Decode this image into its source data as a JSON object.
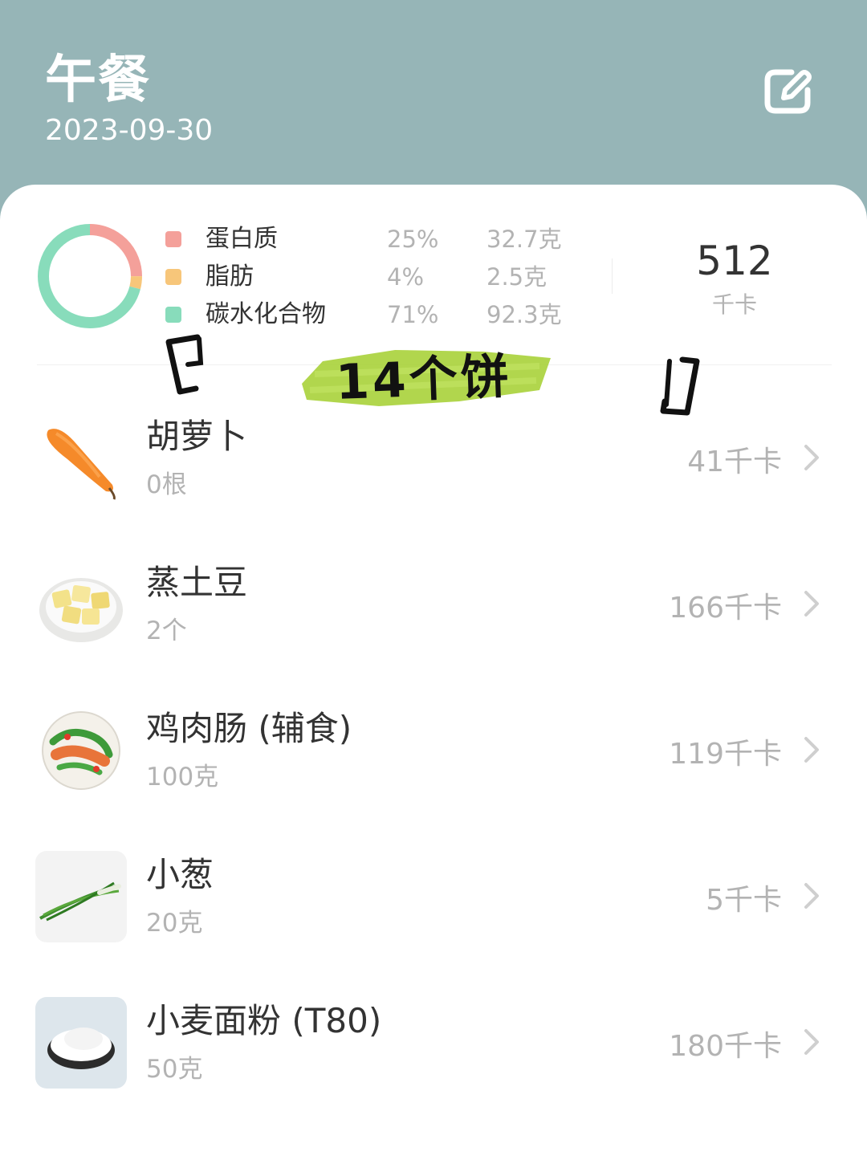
{
  "header": {
    "title": "午餐",
    "date": "2023-09-30",
    "edit_icon": "edit-icon"
  },
  "summary": {
    "macros": [
      {
        "name": "蛋白质",
        "percent": "25%",
        "amount": "32.7克",
        "percent_value": 25,
        "color": "#f4a09a"
      },
      {
        "name": "脂肪",
        "percent": "4%",
        "amount": "2.5克",
        "percent_value": 4,
        "color": "#f7c67a"
      },
      {
        "name": "碳水化合物",
        "percent": "71%",
        "amount": "92.3克",
        "percent_value": 71,
        "color": "#88dcbb"
      }
    ],
    "total_kcal": "512",
    "total_unit": "千卡"
  },
  "annotation": {
    "text": "14个饼",
    "highlight_color": "#a8d13a"
  },
  "foods": [
    {
      "name": "胡萝卜",
      "qty": "0根",
      "kcal": "41千卡",
      "icon": "carrot-image"
    },
    {
      "name": "蒸土豆",
      "qty": "2个",
      "kcal": "166千卡",
      "icon": "steamed-potato-image"
    },
    {
      "name": "鸡肉肠 (辅食)",
      "qty": "100克",
      "kcal": "119千卡",
      "icon": "chicken-sausage-plate-image"
    },
    {
      "name": "小葱",
      "qty": "20克",
      "kcal": "5千卡",
      "icon": "scallion-image"
    },
    {
      "name": "小麦面粉 (T80)",
      "qty": "50克",
      "kcal": "180千卡",
      "icon": "flour-bowl-image"
    }
  ]
}
